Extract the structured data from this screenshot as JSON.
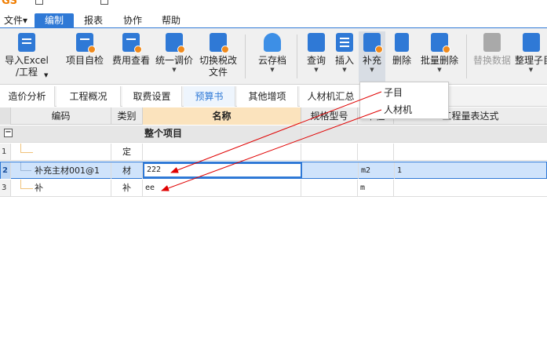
{
  "menubar": {
    "items": [
      {
        "label": "文件▾"
      },
      {
        "label": "编制"
      },
      {
        "label": "报表"
      },
      {
        "label": "协作"
      },
      {
        "label": "帮助"
      }
    ]
  },
  "ribbon": {
    "import_excel": {
      "line1": "导入Excel",
      "line2": "/工程"
    },
    "self_check": "项目自检",
    "fee_view": "费用查看",
    "unified_price": "统一调价",
    "switch_tax": {
      "line1": "切换税改",
      "line2": "文件"
    },
    "cloud_save": "云存档",
    "query": "查询",
    "insert": "插入",
    "supplement": "补充",
    "delete": "删除",
    "batch_delete": "批量删除",
    "replace_data": "替换数据",
    "organize": "整理子目"
  },
  "dropdown": {
    "items": [
      "子目",
      "人材机"
    ]
  },
  "tabs": [
    "造价分析",
    "工程概况",
    "取费设置",
    "预算书",
    "其他增项",
    "人材机汇总"
  ],
  "grid": {
    "headers": {
      "code": "编码",
      "category": "类别",
      "name": "名称",
      "spec": "规格型号",
      "unit": "单位",
      "quantity_expr": "工程量表达式"
    },
    "group_row": {
      "name": "整个项目"
    },
    "rows": [
      {
        "num": "1",
        "code": "",
        "category": "定",
        "name": "",
        "spec": "",
        "unit": "",
        "expr": ""
      },
      {
        "num": "2",
        "code": "补充主材001@1",
        "category": "材",
        "name": "222",
        "spec": "",
        "unit": "m2",
        "expr": "1"
      },
      {
        "num": "3",
        "code": "补",
        "category": "补",
        "name": "ee",
        "spec": "",
        "unit": "m",
        "expr": ""
      }
    ]
  },
  "colors": {
    "accent": "#2f79d6",
    "arrow": "#e00000",
    "orange": "#f07d00"
  }
}
